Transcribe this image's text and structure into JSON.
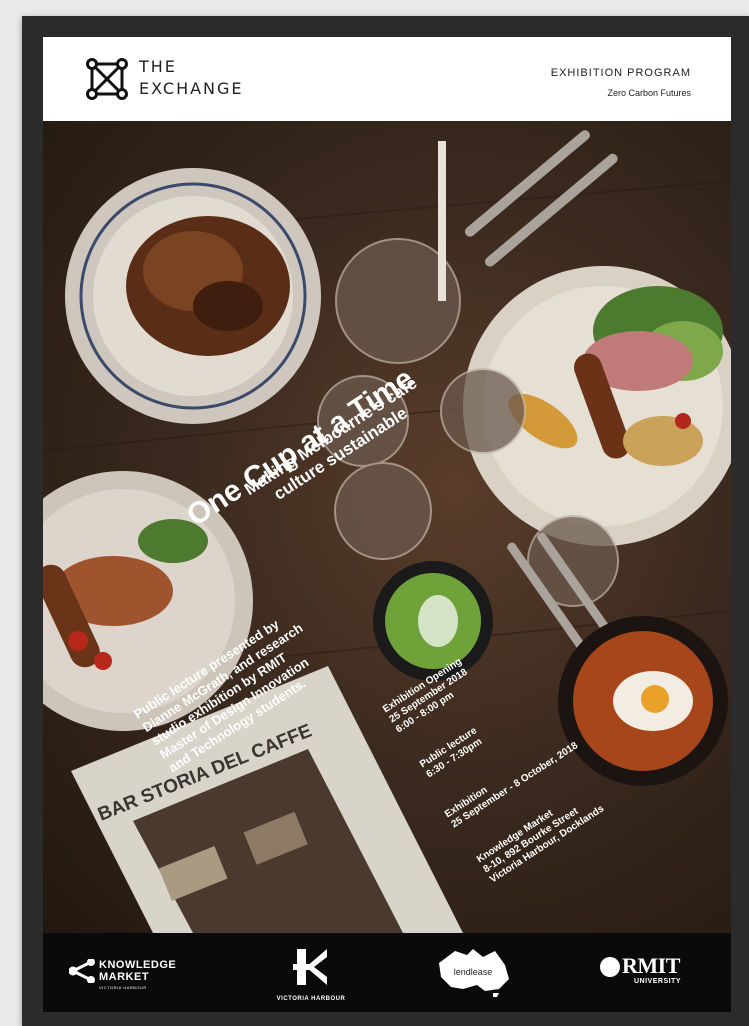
{
  "header": {
    "logo_line1": "THE",
    "logo_line2": "EXCHANGE",
    "program_label": "EXHIBITION PROGRAM",
    "program_series": "Zero Carbon Futures"
  },
  "poster": {
    "title": "One Cup at a Time",
    "subtitle_line1": "Making Melbourne's cafe",
    "subtitle_line2": "culture sustainable",
    "lecture_lines": [
      "Public lecture presented by",
      "Dianne McGrath, and research",
      "studio exhibition by RMIT",
      "Master of Design Innovation",
      "and Technology students."
    ],
    "opening_label": "Exhibition Opening",
    "opening_date": "25 September 2018",
    "opening_time": "6:00 - 8:00 pm",
    "lecture_label": "Public lecture",
    "lecture_time": "6:30 - 7:30pm",
    "exhibition_label": "Exhibition",
    "exhibition_dates": "25 September - 8 October, 2018",
    "venue_name": "Knowledge Market",
    "venue_address": "8-10, 892 Bourke Street",
    "venue_area": "Victoria Harbour, Docklands",
    "newspaper_text": "BAR STORIA DEL CAFFE"
  },
  "footer": {
    "knowledge_line1": "KNOWLEDGE",
    "knowledge_line2": "MARKET",
    "knowledge_sub": "VICTORIA HARBOUR",
    "victoria_harbour": "VICTORIA HARBOUR",
    "lendlease": "lendlease",
    "rmit": "RMIT",
    "rmit_sub": "UNIVERSITY"
  },
  "colors": {
    "header_bg": "#ffffff",
    "footer_bg": "#0a0a0a",
    "frame": "#2b2b2b",
    "accent_green": "#6fa33a"
  },
  "icons": [
    "exchange-logo-icon",
    "share-nodes-icon",
    "victoria-harbour-logo-icon",
    "australia-map-icon",
    "rmit-sun-icon"
  ]
}
